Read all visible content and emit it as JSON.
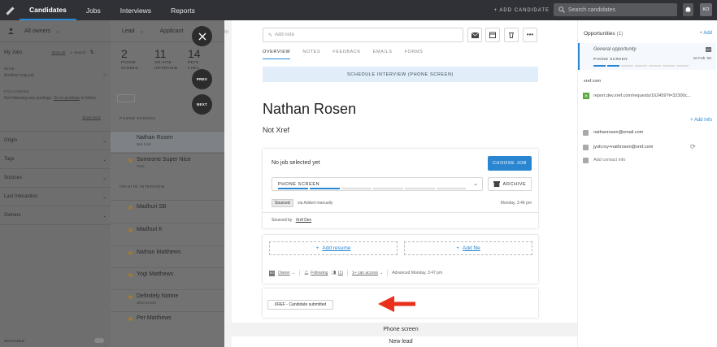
{
  "topnav": {
    "tabs": [
      "Candidates",
      "Jobs",
      "Interviews",
      "Reports"
    ],
    "add_candidate": "+ ADD CANDIDATE",
    "search_placeholder": "Search candidates",
    "user_initials": "KO"
  },
  "sidebar": {
    "owners_label": "All owners",
    "my_jobs": "My Jobs",
    "show_all": "Show all",
    "search": "Search",
    "mine_heading": "MINE",
    "mine_item": "Another crap job",
    "following_heading": "FOLLOWING",
    "following_text": "Not following any postings.",
    "following_link": "Go to postings",
    "following_text2": "to follow.",
    "show_more": "Show more",
    "sections": [
      "Origin",
      "Tags",
      "Sources",
      "Last Interaction",
      "Owners"
    ],
    "snoozed": "SNOOZED"
  },
  "pipeline": {
    "tab_lead": "Lead",
    "tab_applicant": "Applicant",
    "stats": [
      {
        "n": "2",
        "l1": "PHONE",
        "l2": "SCREEN"
      },
      {
        "n": "11",
        "l1": "ON-SITE",
        "l2": "INTERVIEW"
      },
      {
        "n": "14",
        "l1": "REFE",
        "l2": "CHEC"
      }
    ],
    "phone_heading": "PHONE SCREEN",
    "onsite_heading": "ON-SITE INTERVIEW",
    "candidates_phone": [
      {
        "name": "Nathan Rosen",
        "sub": "Not Xref"
      },
      {
        "name": "Someone Super Nice",
        "sub": "Tree"
      }
    ],
    "candidates_onsite": [
      {
        "name": "Madhuri SB",
        "sub": ""
      },
      {
        "name": "Madhuri K",
        "sub": ""
      },
      {
        "name": "Nathan Matthews",
        "sub": ""
      },
      {
        "name": "Yogi Matthews",
        "sub": ""
      },
      {
        "name": "Definitely Notme",
        "sub": "who knows"
      },
      {
        "name": "Per Matthews",
        "sub": ""
      }
    ],
    "prev": "PREV",
    "next": "NEXT"
  },
  "main": {
    "add_note_placeholder": "Add note",
    "tabs": [
      "OVERVIEW",
      "NOTES",
      "FEEDBACK",
      "EMAILS",
      "FORMS"
    ],
    "banner": "SCHEDULE INTERVIEW (PHONE SCREEN)",
    "candidate_name": "Nathan Rosen",
    "candidate_company": "Not Xref",
    "job_card": {
      "no_job": "No job selected yet",
      "choose_job": "CHOOSE JOB",
      "stage": "PHONE SCREEN",
      "archive": "ARCHIVE",
      "badge": "Sourced",
      "via": "via Added manually",
      "date": "Monday, 3:46 pm",
      "sourced_by_label": "Sourced by",
      "sourced_by": "Xref Dev"
    },
    "files": {
      "add_resume": "Add resume",
      "add_file": "Add file",
      "owner": "Owner",
      "following": "Following",
      "follower_count": "(1)",
      "access": "1+ can access",
      "advanced": "Advanced Monday, 3:47 pm",
      "owner_initials": "KO"
    },
    "xref_button": "XREF - Candidate submitted",
    "phone_screen_divider": "Phone screen",
    "new_lead": "New lead"
  },
  "right": {
    "opportunities_label": "Opportunities",
    "opportunities_count": "(1)",
    "add": "Add",
    "opp_title": "General opportunity",
    "opp_stage": "PHONE SCREEN",
    "opp_date": "10 Feb '20",
    "opp_initials": "KO",
    "xref_label": "xref.com",
    "xref_link": "report.dev.xref.com/requests/162459?t=32300c...",
    "add_info": "Add info",
    "email1": "nathanrosen@email.com",
    "email2": "jyoti.roy+nathrosen@xref.com",
    "add_contact": "Add contact info"
  },
  "colors": {
    "accent": "#2a86d1",
    "arrow": "#e8301d",
    "nav_bg": "#2f3136"
  }
}
